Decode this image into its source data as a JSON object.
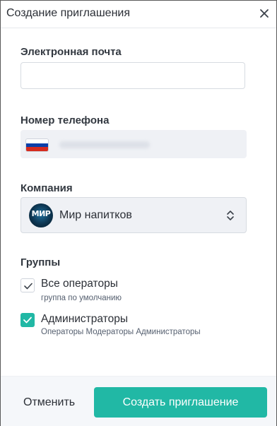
{
  "dialog": {
    "title": "Создание приглашения",
    "close_icon": "close-icon"
  },
  "email": {
    "label": "Электронная почта",
    "value": "",
    "placeholder": ""
  },
  "phone": {
    "label": "Номер телефона",
    "country_flag": "russia-flag-icon",
    "value_blurred": true
  },
  "company": {
    "label": "Компания",
    "logo_text": "МИР",
    "selected": "Мир напитков",
    "arrows_icon": "select-arrows-icon"
  },
  "groups": {
    "label": "Группы",
    "items": [
      {
        "name": "Все операторы",
        "description": "группа по умолчанию",
        "checked": false
      },
      {
        "name": "Администраторы",
        "description": "Операторы Модераторы Администраторы",
        "checked": true
      }
    ]
  },
  "footer": {
    "cancel_label": "Отменить",
    "submit_label": "Создать приглашение"
  },
  "colors": {
    "accent": "#21b8a5",
    "field_bg": "#eff1f5",
    "footer_bg": "#f5f7fa",
    "flag_white": "#ffffff",
    "flag_blue": "#0b3fa8",
    "flag_red": "#d52b1e"
  }
}
